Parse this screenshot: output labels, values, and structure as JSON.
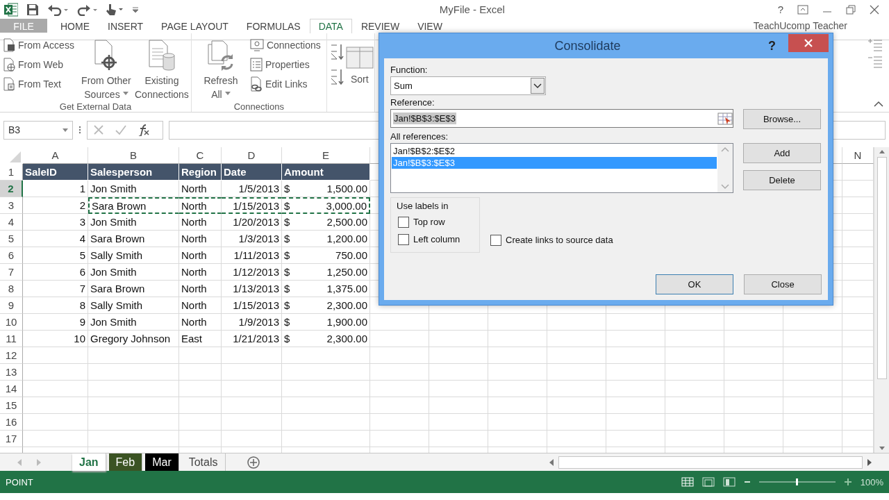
{
  "window": {
    "title": "MyFile - Excel",
    "help": "?",
    "account": "TeachUcomp Teacher"
  },
  "ribbon_tabs": [
    {
      "label": "FILE",
      "kind": "file",
      "selected": false
    },
    {
      "label": "HOME",
      "kind": "tab",
      "selected": false
    },
    {
      "label": "INSERT",
      "kind": "tab",
      "selected": false
    },
    {
      "label": "PAGE LAYOUT",
      "kind": "tab",
      "selected": false
    },
    {
      "label": "FORMULAS",
      "kind": "tab",
      "selected": false
    },
    {
      "label": "DATA",
      "kind": "tab",
      "selected": true
    },
    {
      "label": "REVIEW",
      "kind": "tab",
      "selected": false
    },
    {
      "label": "VIEW",
      "kind": "tab",
      "selected": false
    }
  ],
  "ribbon_groups": [
    {
      "label": "Get External Data",
      "items": [
        {
          "kind": "small_stack",
          "commands": [
            {
              "label": "From Access"
            },
            {
              "label": "From Web"
            },
            {
              "label": "From Text"
            }
          ]
        },
        {
          "kind": "large",
          "lines": [
            "From Other",
            "Sources"
          ],
          "dropdown": true
        },
        {
          "kind": "large",
          "lines": [
            "Existing",
            "Connections"
          ],
          "dropdown": false
        }
      ]
    },
    {
      "label": "Connections",
      "items": [
        {
          "kind": "large",
          "lines": [
            "Refresh",
            "All"
          ],
          "dropdown": true
        },
        {
          "kind": "small_stack",
          "commands": [
            {
              "label": "Connections"
            },
            {
              "label": "Properties"
            },
            {
              "label": "Edit Links"
            }
          ]
        }
      ]
    },
    {
      "items": [
        {
          "kind": "sort",
          "lines": [
            "Sort"
          ]
        }
      ]
    }
  ],
  "formula_bar": {
    "name_box": "B3"
  },
  "sheet": {
    "columns": [
      "A",
      "B",
      "C",
      "D",
      "E"
    ],
    "far_column": "N",
    "rows": [
      {
        "number": "1",
        "kind": "header",
        "cells": [
          "SaleID",
          "Salesperson",
          "Region",
          "Date",
          "Amount"
        ]
      },
      {
        "number": "2",
        "kind": "data",
        "active": true,
        "marquee": false,
        "cells": [
          "1",
          "Jon Smith",
          "North",
          "1/5/2013",
          "$",
          "1,500.00"
        ]
      },
      {
        "number": "3",
        "kind": "data",
        "active": false,
        "marquee": true,
        "cells": [
          "2",
          "Sara Brown",
          "North",
          "1/15/2013",
          "$",
          "3,000.00"
        ]
      },
      {
        "number": "4",
        "kind": "data",
        "active": false,
        "marquee": false,
        "cells": [
          "3",
          "Jon Smith",
          "North",
          "1/20/2013",
          "$",
          "2,500.00"
        ]
      },
      {
        "number": "5",
        "kind": "data",
        "active": false,
        "marquee": false,
        "cells": [
          "4",
          "Sara Brown",
          "North",
          "1/3/2013",
          "$",
          "1,200.00"
        ]
      },
      {
        "number": "6",
        "kind": "data",
        "active": false,
        "marquee": false,
        "cells": [
          "5",
          "Sally Smith",
          "North",
          "1/11/2013",
          "$",
          "750.00"
        ]
      },
      {
        "number": "7",
        "kind": "data",
        "active": false,
        "marquee": false,
        "cells": [
          "6",
          "Jon Smith",
          "North",
          "1/12/2013",
          "$",
          "1,250.00"
        ]
      },
      {
        "number": "8",
        "kind": "data",
        "active": false,
        "marquee": false,
        "cells": [
          "7",
          "Sara Brown",
          "North",
          "1/13/2013",
          "$",
          "1,375.00"
        ]
      },
      {
        "number": "9",
        "kind": "data",
        "active": false,
        "marquee": false,
        "cells": [
          "8",
          "Sally Smith",
          "North",
          "1/15/2013",
          "$",
          "2,300.00"
        ]
      },
      {
        "number": "10",
        "kind": "data",
        "active": false,
        "marquee": false,
        "cells": [
          "9",
          "Jon Smith",
          "North",
          "1/9/2013",
          "$",
          "1,900.00"
        ]
      },
      {
        "number": "11",
        "kind": "data",
        "active": false,
        "marquee": false,
        "cells": [
          "10",
          "Gregory Johnson",
          "East",
          "1/21/2013",
          "$",
          "2,300.00"
        ]
      },
      {
        "number": "12",
        "kind": "empty"
      },
      {
        "number": "13",
        "kind": "empty"
      },
      {
        "number": "14",
        "kind": "empty"
      },
      {
        "number": "15",
        "kind": "empty"
      },
      {
        "number": "16",
        "kind": "empty"
      },
      {
        "number": "17",
        "kind": "empty"
      }
    ]
  },
  "sheet_tabs": [
    {
      "label": "Jan",
      "selected": true
    },
    {
      "label": "Feb",
      "selected": false,
      "color": "#3b5323"
    },
    {
      "label": "Mar",
      "selected": false,
      "color": "#000000"
    },
    {
      "label": "Totals",
      "selected": false
    }
  ],
  "status_bar": {
    "mode": "POINT",
    "zoom": "100%"
  },
  "dialog": {
    "title": "Consolidate",
    "help": "?",
    "function_label": "Function:",
    "function": "Sum",
    "reference_label": "Reference:",
    "reference": "Jan!$B$3:$E$3",
    "reference_highlighted": true,
    "browse": "Browse...",
    "all_references_label": "All references:",
    "references": [
      {
        "text": "Jan!$B$2:$E$2",
        "selected": false
      },
      {
        "text": "Jan!$B$3:$E$3",
        "selected": true
      }
    ],
    "add": "Add",
    "delete": "Delete",
    "labels_group": "Use labels in",
    "label_options": [
      {
        "label": "Top row",
        "checked": false
      },
      {
        "label": "Left column",
        "checked": false
      }
    ],
    "create_links": {
      "label": "Create links to source data",
      "checked": false
    },
    "ok": "OK",
    "close": "Close"
  }
}
